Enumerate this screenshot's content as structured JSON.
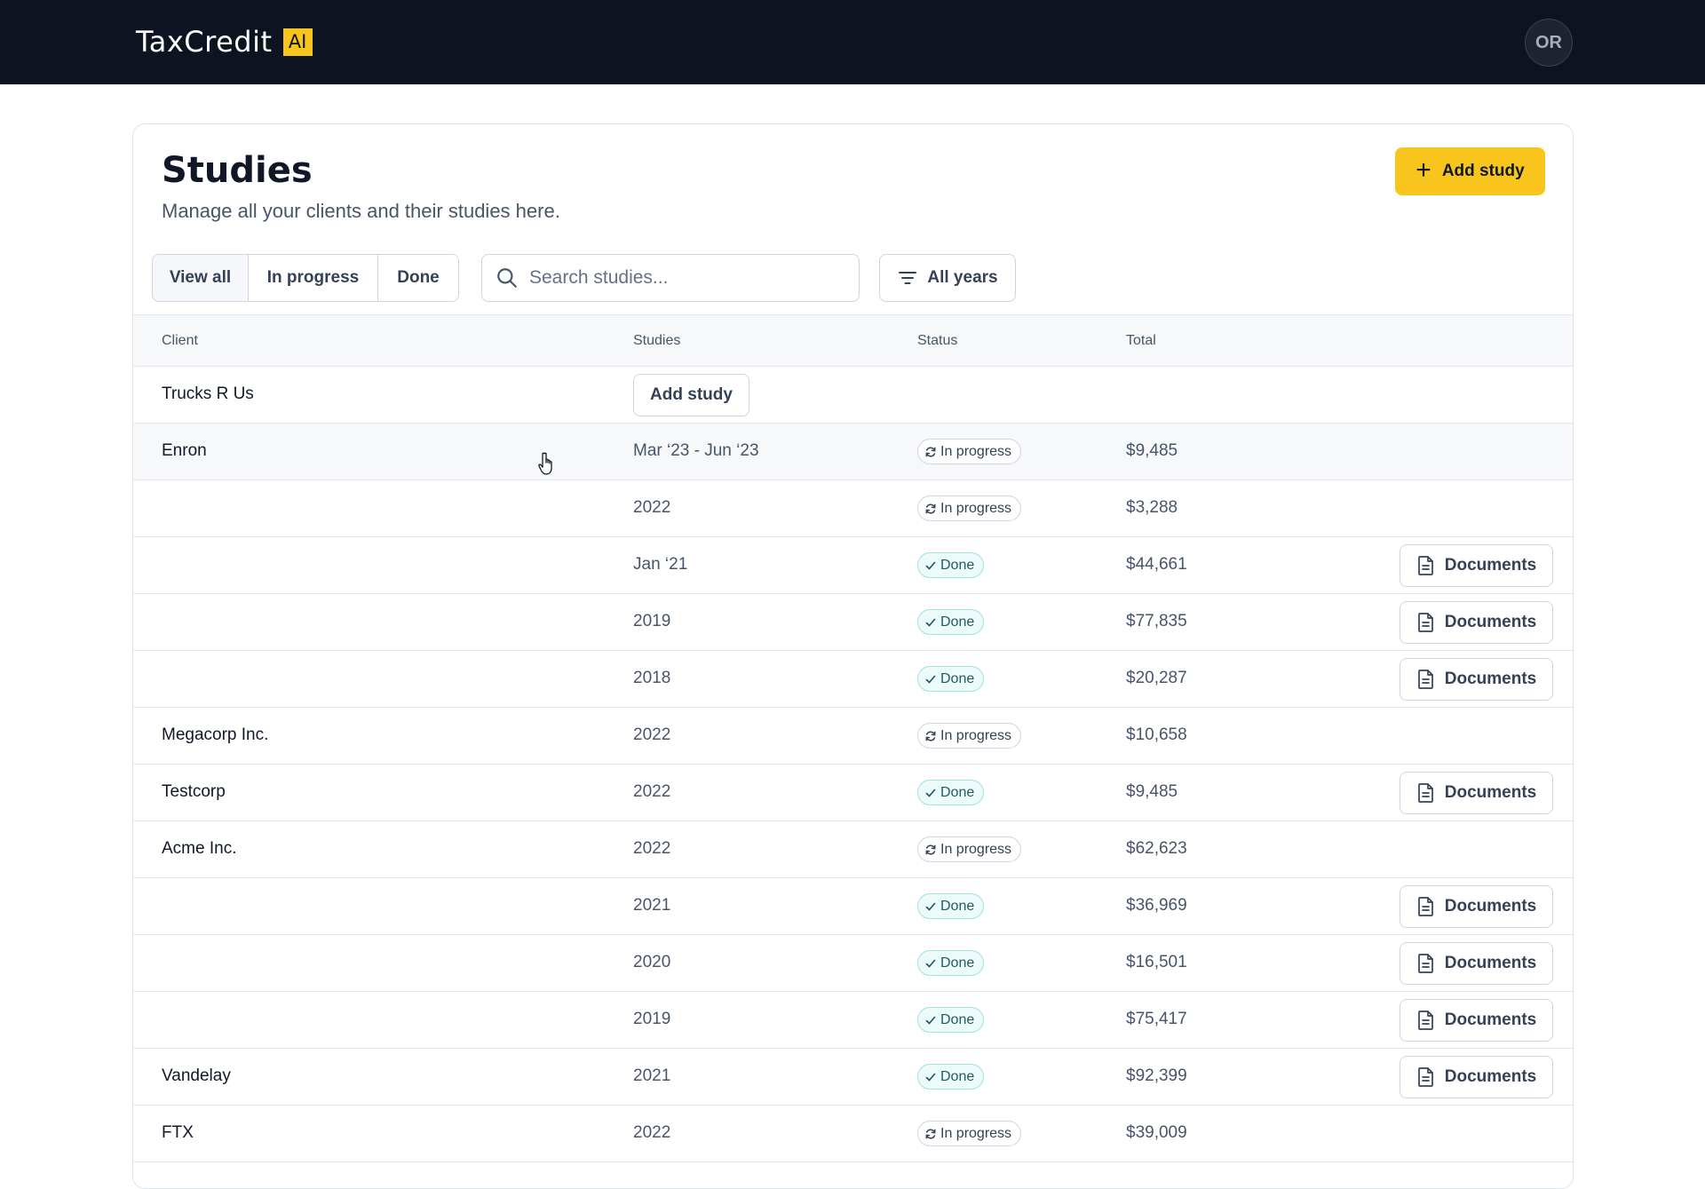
{
  "app": {
    "logo_text": "TaxCredit",
    "logo_badge": "AI",
    "avatar_initials": "OR"
  },
  "page": {
    "title": "Studies",
    "subtitle": "Manage all your clients and their studies here.",
    "add_study_label": "Add study"
  },
  "filters": {
    "tabs": [
      "View all",
      "In progress",
      "Done"
    ],
    "active_tab": "View all",
    "search_placeholder": "Search studies...",
    "years_label": "All years"
  },
  "table": {
    "columns": {
      "client": "Client",
      "studies": "Studies",
      "status": "Status",
      "total": "Total"
    },
    "row_add_study_label": "Add study",
    "documents_label": "Documents",
    "rows": [
      {
        "client": "Trucks R Us",
        "study": "",
        "status": "",
        "total": "",
        "add_study": true
      },
      {
        "client": "Enron",
        "study": "Mar ‘23 - Jun ‘23",
        "status": "In progress",
        "total": "$9,485",
        "hover": true
      },
      {
        "client": "",
        "study": "2022",
        "status": "In progress",
        "total": "$3,288"
      },
      {
        "client": "",
        "study": "Jan ‘21",
        "status": "Done",
        "total": "$44,661"
      },
      {
        "client": "",
        "study": "2019",
        "status": "Done",
        "total": "$77,835"
      },
      {
        "client": "",
        "study": "2018",
        "status": "Done",
        "total": "$20,287"
      },
      {
        "client": "Megacorp Inc.",
        "study": "2022",
        "status": "In progress",
        "total": "$10,658"
      },
      {
        "client": "Testcorp",
        "study": "2022",
        "status": "Done",
        "total": "$9,485"
      },
      {
        "client": "Acme Inc.",
        "study": "2022",
        "status": "In progress",
        "total": "$62,623"
      },
      {
        "client": "",
        "study": "2021",
        "status": "Done",
        "total": "$36,969"
      },
      {
        "client": "",
        "study": "2020",
        "status": "Done",
        "total": "$16,501"
      },
      {
        "client": "",
        "study": "2019",
        "status": "Done",
        "total": "$75,417"
      },
      {
        "client": "Vandelay",
        "study": "2021",
        "status": "Done",
        "total": "$92,399"
      },
      {
        "client": "FTX",
        "study": "2022",
        "status": "In progress",
        "total": "$39,009"
      }
    ]
  },
  "colors": {
    "topbar": "#0e1322",
    "accent": "#f8c51c",
    "done_badge_border": "#9ee3dc"
  }
}
